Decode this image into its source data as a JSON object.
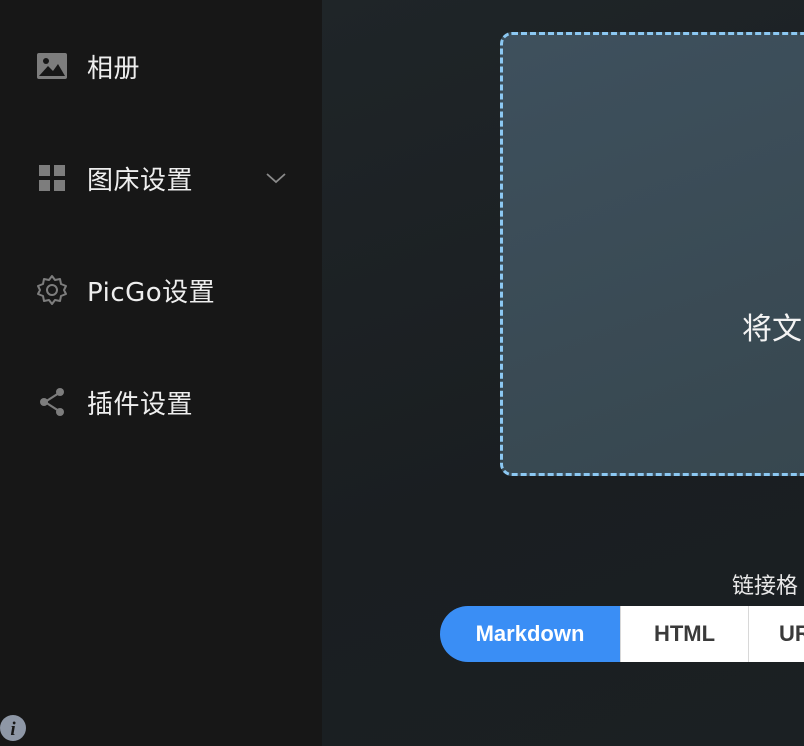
{
  "sidebar": {
    "items": [
      {
        "label": "相册",
        "icon": "image-icon"
      },
      {
        "label": "图床设置",
        "icon": "grid-icon",
        "has_submenu": true
      },
      {
        "label": "PicGo设置",
        "icon": "gear-icon"
      },
      {
        "label": "插件设置",
        "icon": "share-icon"
      }
    ],
    "footer_icon": "info-icon"
  },
  "upload": {
    "dropzone_text": "将文",
    "format_label": "链接格",
    "formats": [
      "Markdown",
      "HTML",
      "UR"
    ],
    "selected_format": "Markdown"
  },
  "colors": {
    "accent": "#3a8ef5",
    "dropzone_border": "#8cc8f2",
    "sidebar_bg": "#171717"
  }
}
